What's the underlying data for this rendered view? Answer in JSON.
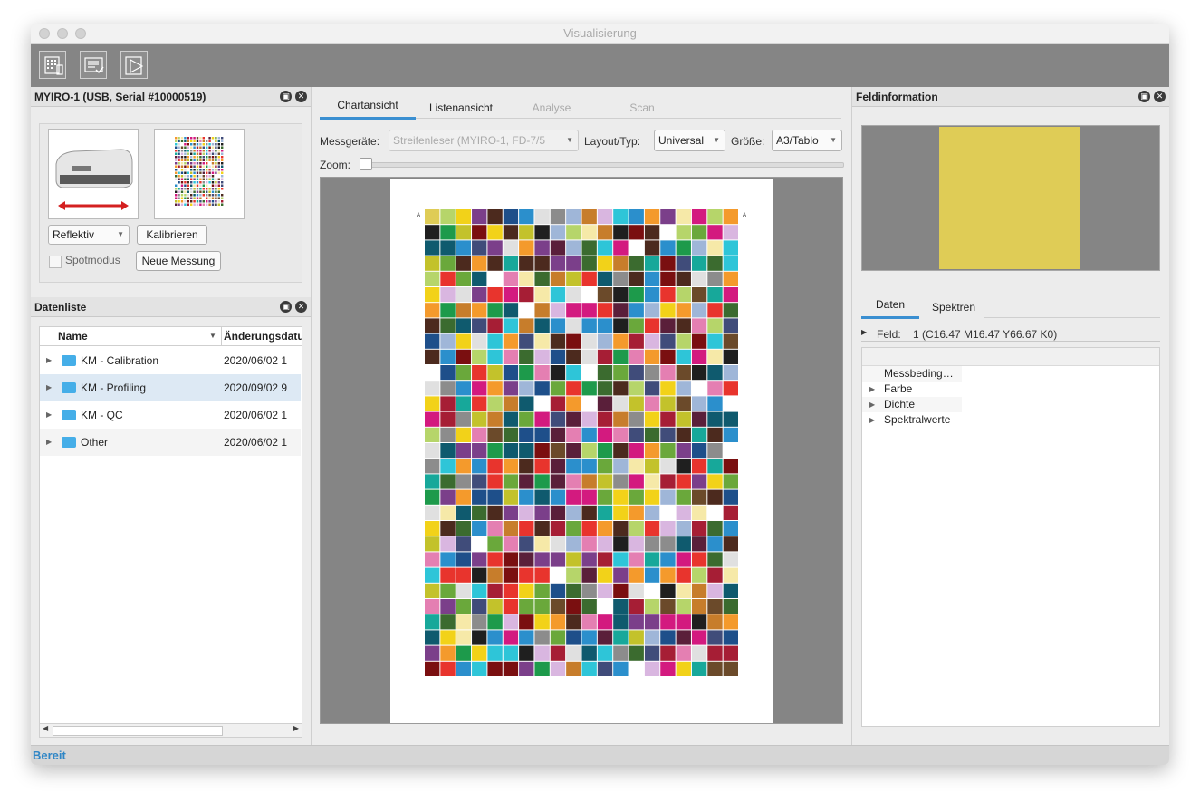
{
  "window": {
    "title": "Visualisierung"
  },
  "device_panel": {
    "title": "MYIRO-1 (USB, Serial #10000519)",
    "mode_select": "Reflektiv",
    "calibrate_label": "Kalibrieren",
    "spot_mode_label": "Spotmodus",
    "new_measure_label": "Neue Messung"
  },
  "data_list": {
    "title": "Datenliste",
    "columns": [
      "Name",
      "Änderungsdatu"
    ],
    "rows": [
      {
        "name": "KM - Calibration",
        "date": "2020/06/02 1"
      },
      {
        "name": "KM - Profiling",
        "date": "2020/09/02 9"
      },
      {
        "name": "KM - QC",
        "date": "2020/06/02 1"
      },
      {
        "name": "Other",
        "date": "2020/06/02 1"
      }
    ]
  },
  "center": {
    "tabs": [
      "Chartansicht",
      "Listenansicht",
      "Analyse",
      "Scan"
    ],
    "device_label": "Messgeräte:",
    "device_value": "Streifenleser (MYIRO-1, FD-7/5",
    "layout_label": "Layout/Typ:",
    "layout_value": "Universal",
    "size_label": "Größe:",
    "size_value": "A3/Tablo",
    "zoom_label": "Zoom:",
    "chart_row_marker": "A"
  },
  "field_info": {
    "title": "Feldinformation",
    "tabs": [
      "Daten",
      "Spektren"
    ],
    "feld_label": "Feld:",
    "feld_value": "1 (C16.47 M16.47 Y66.67 K0)",
    "props": [
      "Messbeding…",
      "Farbe",
      "Dichte",
      "Spektralwerte"
    ]
  },
  "status": {
    "text": "Bereit"
  },
  "colors": {
    "swatch": "#dfcc56",
    "accent": "#3a8fd1",
    "status_text": "#2f86c6"
  }
}
